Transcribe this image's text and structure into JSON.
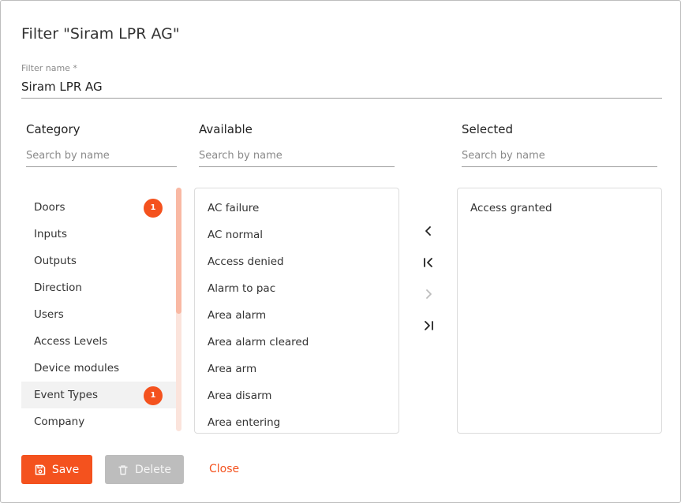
{
  "dialog": {
    "title": "Filter \"Siram LPR AG\""
  },
  "filter_name": {
    "label": "Filter name *",
    "value": "Siram LPR AG"
  },
  "columns": {
    "category": {
      "heading": "Category",
      "search_placeholder": "Search by name"
    },
    "available": {
      "heading": "Available",
      "search_placeholder": "Search by name"
    },
    "selected": {
      "heading": "Selected",
      "search_placeholder": "Search by name"
    }
  },
  "categories": [
    {
      "label": "Doors",
      "badge": "1"
    },
    {
      "label": "Inputs",
      "badge": ""
    },
    {
      "label": "Outputs",
      "badge": ""
    },
    {
      "label": "Direction",
      "badge": ""
    },
    {
      "label": "Users",
      "badge": ""
    },
    {
      "label": "Access Levels",
      "badge": ""
    },
    {
      "label": "Device modules",
      "badge": ""
    },
    {
      "label": "Event Types",
      "badge": "1",
      "selected": true
    },
    {
      "label": "Company",
      "badge": ""
    }
  ],
  "available_items": [
    "AC failure",
    "AC normal",
    "Access denied",
    "Alarm to pac",
    "Area alarm",
    "Area alarm cleared",
    "Area arm",
    "Area disarm",
    "Area entering"
  ],
  "selected_items": [
    "Access granted"
  ],
  "transfer": {
    "move_left_icon": "chevron-left-icon",
    "move_all_left_icon": "chevron-left-bar-icon",
    "move_right_icon": "chevron-right-icon",
    "move_all_right_icon": "chevron-right-bar-icon"
  },
  "actions": {
    "save_label": "Save",
    "delete_label": "Delete",
    "close_label": "Close"
  },
  "colors": {
    "accent": "#f4521e",
    "disabled": "#bdbdbd"
  }
}
